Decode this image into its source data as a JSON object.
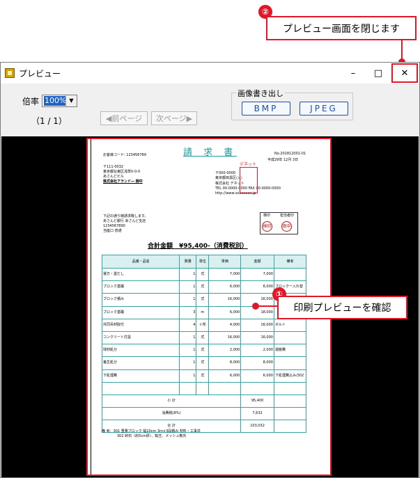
{
  "annotations": {
    "close": {
      "number": "②",
      "text": "プレビュー画面を閉じます"
    },
    "preview": {
      "number": "①",
      "text": "印刷プレビューを確認"
    }
  },
  "window": {
    "title": "プレビュー",
    "minimize_glyph": "–",
    "maximize_glyph": "□",
    "close_glyph": "✕"
  },
  "toolbar": {
    "zoom_label": "倍率",
    "zoom_value": "100%",
    "page_indicator": "（1 / 1）",
    "prev_page": "◀前ページ",
    "next_page": "次ページ▶",
    "image_export_label": "画像書き出し",
    "bmp": "BMP",
    "jpeg": "JPEG"
  },
  "invoice": {
    "title": "請 求 書",
    "customer_code": "お客様コード: 123456789",
    "doc_no": "No.201812001-01",
    "date": "平成29年 12月 3日",
    "to_zip": "〒111-0032",
    "to_addr": "東京都台東区浅草0-0-0",
    "to_bldg": "あさんどビル",
    "to_company": "株式会社アランド― 御中",
    "from_zip": "〒000-0000",
    "from_addr": "東京都目黒区○○",
    "from_company": "株式会社 デネット",
    "from_tel": "TEL 00-0000-0000 FAX 00-0000-0000",
    "from_url": "http://www.xxxxxxxx.jp",
    "stamp_line": "デネット",
    "request_text": "下記の通り御請求致します。",
    "bank": "あさんど銀行 あさんど支店",
    "account": "1234567890",
    "holder": "当座口 普通",
    "approve_headers": [
      "検印",
      "担当者印"
    ],
    "seal_left": "検印",
    "seal_right": "田中",
    "total_line": "合計金額　¥95,400-（消費税別）",
    "headers": [
      "品番・品名",
      "数量",
      "単位",
      "単価",
      "金額",
      "備考"
    ],
    "rows": [
      [
        "遣方・墨だし",
        "1",
        "式",
        "7,000",
        "7,000",
        ""
      ],
      [
        "ブロック基礎",
        "1",
        "式",
        "6,000",
        "6,000",
        "ブロック一入れ替"
      ],
      [
        "ブロック積み",
        "1",
        "式",
        "16,000",
        "16,000",
        ""
      ],
      [
        "ブロック基礎",
        "3",
        "m",
        "6,000",
        "18,000",
        ""
      ],
      [
        "共同吊材取付",
        "4",
        "ヶ所",
        "4,000",
        "16,000",
        "ボルト"
      ],
      [
        "コンクリート打設",
        "1",
        "式",
        "16,000",
        "16,000",
        ""
      ],
      [
        "残材処分",
        "1",
        "式",
        "2,000",
        "2,000",
        "運搬費"
      ],
      [
        "養生処分",
        "1",
        "式",
        "8,000",
        "8,000",
        ""
      ],
      [
        "下処理費",
        "1",
        "式",
        "6,000",
        "6,000",
        "下処理費込み/302"
      ],
      [
        "",
        "",
        "",
        "",
        "",
        ""
      ]
    ],
    "subtotal_label": "小 計",
    "subtotal": "95,400",
    "tax_label": "消費税(8%)",
    "tax": "7,632",
    "total_label": "合 計",
    "total": "103,032",
    "notes1": "備 考：301 重量ブロック 幅10cm 3m×3段積み 材料・工事共",
    "notes2": "302 砕石（約5cm厚）、転圧、メッシュ敷共"
  }
}
